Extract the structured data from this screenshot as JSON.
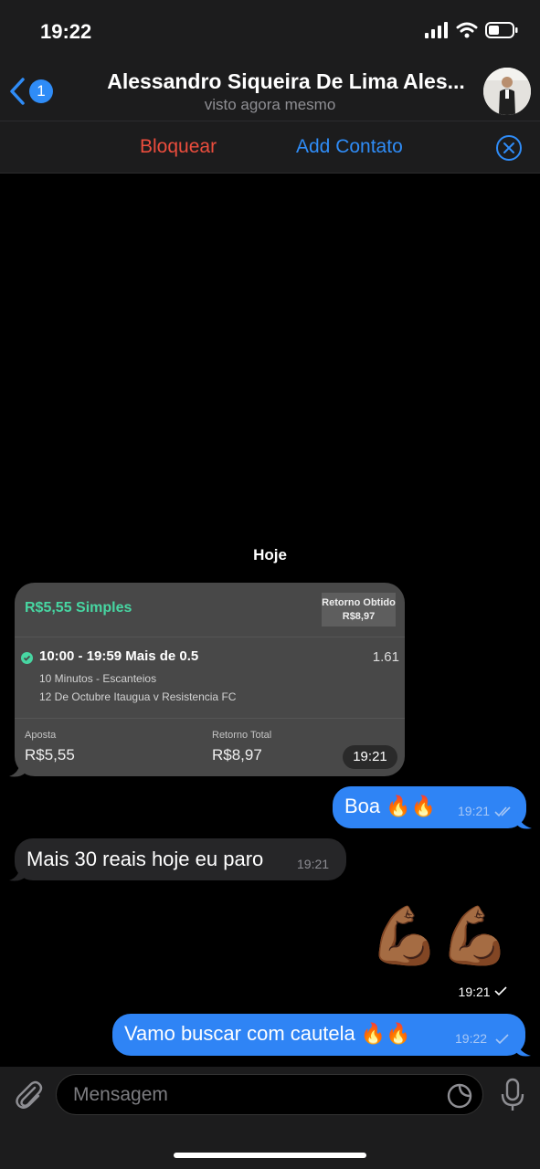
{
  "status_bar": {
    "time": "19:22"
  },
  "header": {
    "back_badge": "1",
    "title": "Alessandro Siqueira De Lima Ales...",
    "subtitle": "visto agora mesmo"
  },
  "actions": {
    "block_label": "Bloquear",
    "add_contact_label": "Add Contato"
  },
  "date_label": "Hoje",
  "bet_card": {
    "title": "R$5,55 Simples",
    "retorno_obtido_label": "Retorno Obtido",
    "retorno_obtido_value": "R$8,97",
    "selection": "10:00 - 19:59 Mais de 0.5",
    "odd": "1.61",
    "market": "10 Minutos - Escanteios",
    "match": "12 De Octubre Itaugua v Resistencia FC",
    "aposta_label": "Aposta",
    "aposta_value": "R$5,55",
    "retorno_total_label": "Retorno Total",
    "retorno_total_value": "R$8,97",
    "time": "19:21"
  },
  "messages": {
    "out1": {
      "text": "Boa 🔥🔥",
      "time": "19:21"
    },
    "in1": {
      "text": "Mais 30 reais hoje eu paro",
      "time": "19:21"
    },
    "sticker": {
      "emoji": "💪🏾💪🏾",
      "time": "19:21"
    },
    "out2": {
      "text": "Vamo buscar com cautela 🔥🔥",
      "time": "19:22"
    }
  },
  "input": {
    "placeholder": "Mensagem"
  },
  "colors": {
    "accent": "#2f8cf7",
    "block": "#eb4d3d",
    "outgoing": "#2f84f5",
    "incoming": "#262628",
    "bet_green": "#47d6a2"
  }
}
